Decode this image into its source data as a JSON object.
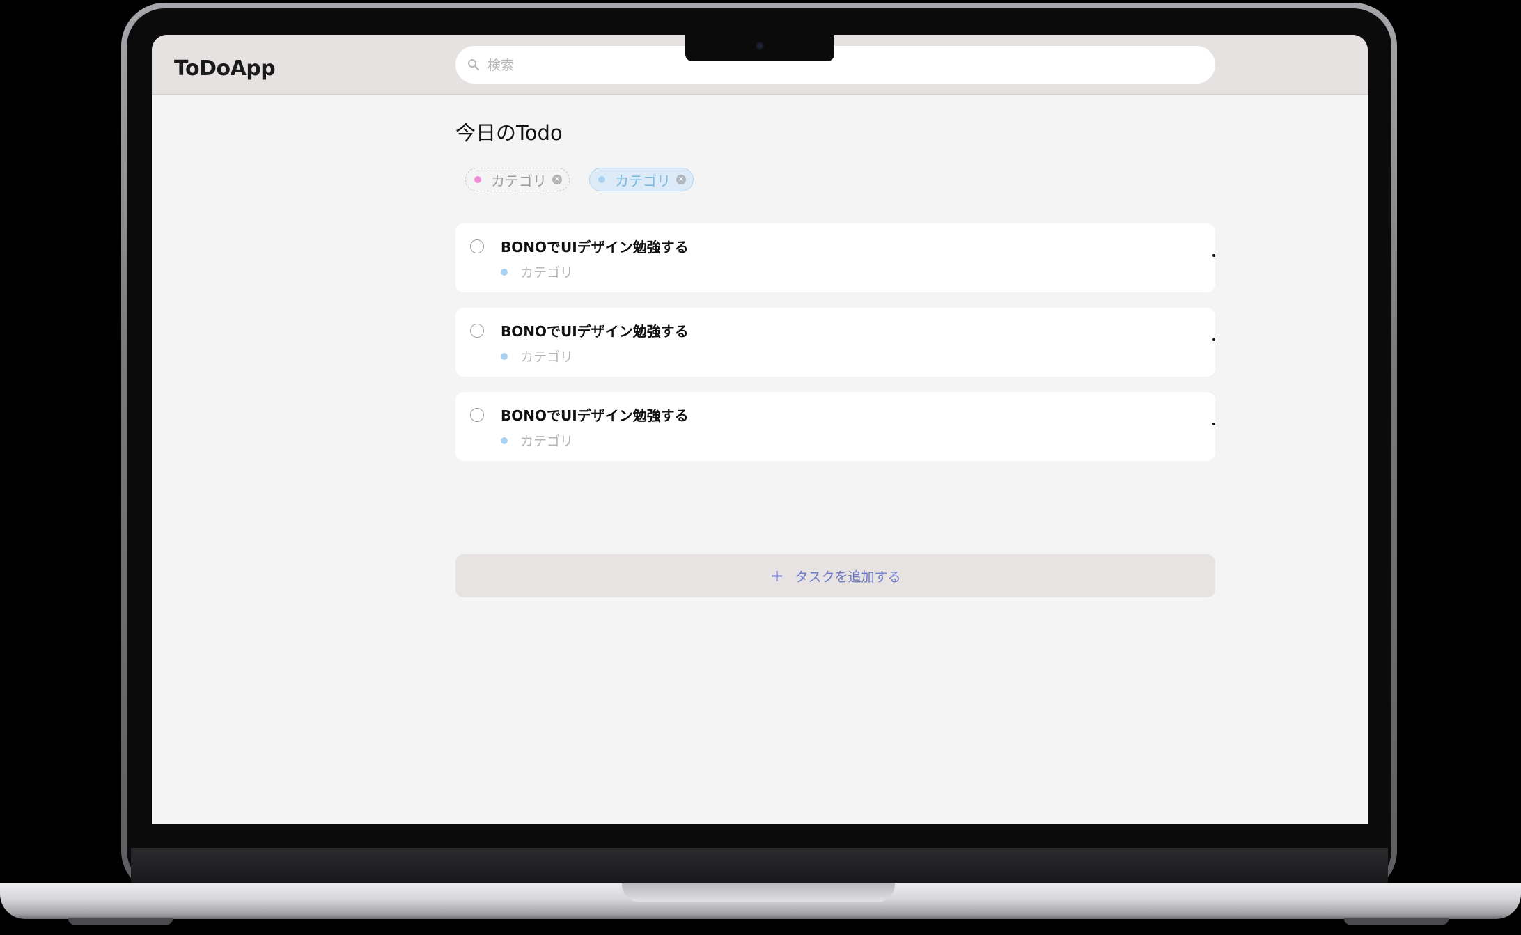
{
  "app": {
    "logo": "ToDoApp",
    "search": {
      "placeholder": "検索"
    }
  },
  "main": {
    "title": "今日のTodo",
    "filters": [
      {
        "label": "カテゴリ",
        "color": "#f28ad8",
        "style": "dashed"
      },
      {
        "label": "カテゴリ",
        "color": "#7bb8e0",
        "style": "selected"
      }
    ],
    "tasks": [
      {
        "title": "BONOでUIデザイン勉強する",
        "category": "カテゴリ",
        "category_color": "#a9d2f0",
        "done": false
      },
      {
        "title": "BONOでUIデザイン勉強する",
        "category": "カテゴリ",
        "category_color": "#a9d2f0",
        "done": false
      },
      {
        "title": "BONOでUIデザイン勉強する",
        "category": "カテゴリ",
        "category_color": "#a9d2f0",
        "done": false
      }
    ],
    "add_task": {
      "icon": "+",
      "label": "タスクを追加する"
    }
  },
  "colors": {
    "header_bg": "#e5e2e1",
    "page_bg": "#f4f4f4",
    "accent": "#6e78c8"
  }
}
